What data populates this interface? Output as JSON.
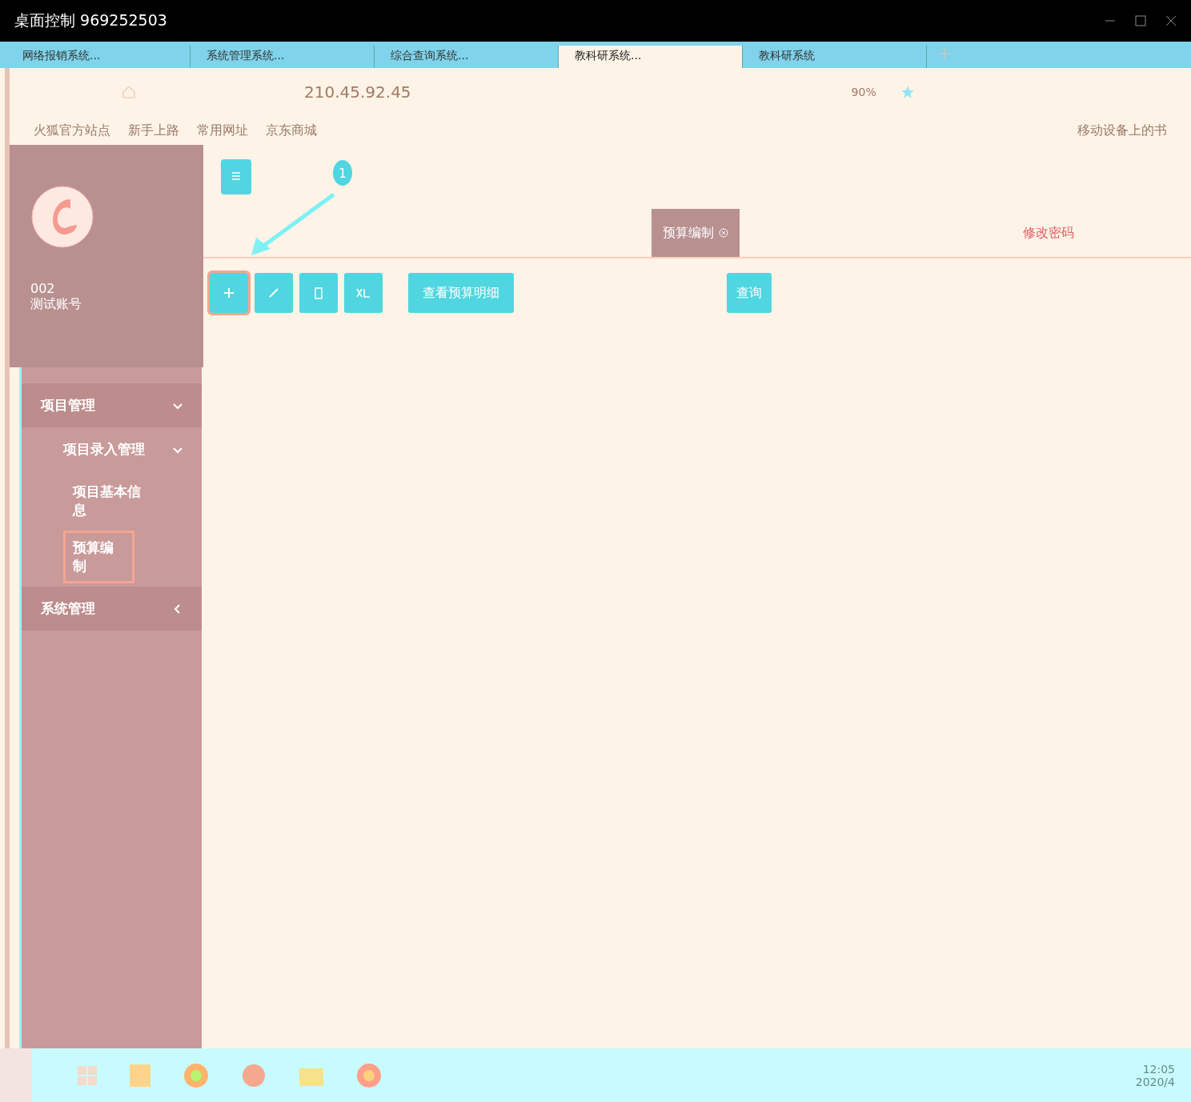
{
  "window": {
    "title": "桌面控制 969252503"
  },
  "browser_tabs": [
    {
      "label": "网络报销系统...",
      "selected": false
    },
    {
      "label": "系统管理系统...",
      "selected": false
    },
    {
      "label": "综合查询系统...",
      "selected": false
    },
    {
      "label": "教科研系统...",
      "selected": true
    },
    {
      "label": "教科研系统",
      "selected": false
    }
  ],
  "address_bar": {
    "url": "210.45.92.45",
    "zoom": "90%"
  },
  "bookmarks": [
    "火狐官方站点",
    "新手上路",
    "常用网址",
    "京东商城"
  ],
  "bookmarks_right": "移动设备上的书",
  "user": {
    "id": "002",
    "name": "测试账号"
  },
  "sidebar": {
    "items": [
      {
        "label": "项目管理",
        "expanded": true,
        "children": [
          {
            "label": "项目录入管理",
            "expanded": true,
            "children": [
              {
                "label": "项目基本信息",
                "selected": false,
                "highlighted": false
              },
              {
                "label": "预算编制",
                "selected": true,
                "highlighted": true
              }
            ]
          }
        ]
      },
      {
        "label": "系统管理",
        "expanded": false
      }
    ]
  },
  "annotation": {
    "label": "1"
  },
  "page_tabs": [
    {
      "label": "预算编制",
      "selected": true,
      "closable": true
    },
    {
      "label": "修改密码",
      "selected": false,
      "closable": false
    }
  ],
  "toolbar": [
    {
      "kind": "add",
      "highlighted": true
    },
    {
      "kind": "edit",
      "highlighted": false
    },
    {
      "kind": "delete",
      "highlighted": false
    },
    {
      "kind": "excel",
      "highlighted": false
    },
    {
      "kind": "text",
      "label": "查看预算明细",
      "highlighted": false
    }
  ],
  "search_button": "查询",
  "taskbar": {
    "time": "12:05",
    "date": "2020/4"
  }
}
